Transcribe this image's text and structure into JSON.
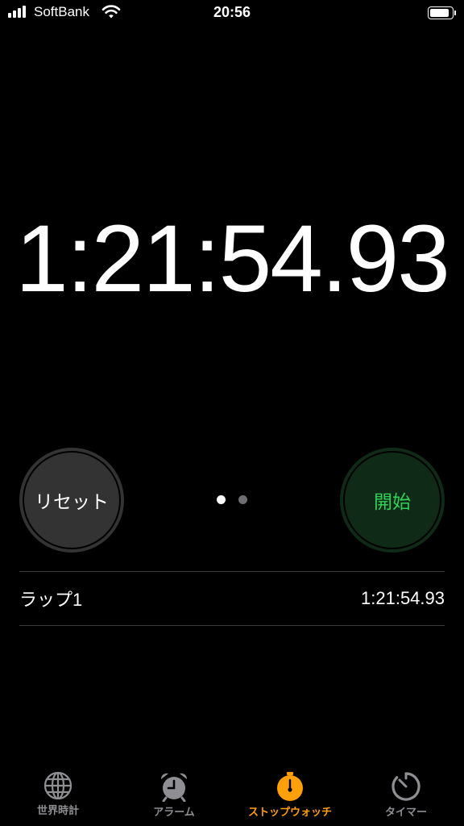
{
  "status_bar": {
    "carrier": "SoftBank",
    "time": "20:56",
    "battery_level": 0.9
  },
  "stopwatch": {
    "elapsed": "1:21:54.93"
  },
  "controls": {
    "reset_label": "リセット",
    "start_label": "開始",
    "page_count": 2,
    "current_page": 1
  },
  "laps": [
    {
      "label": "ラップ1",
      "time": "1:21:54.93"
    }
  ],
  "tabs": [
    {
      "label": "世界時計",
      "icon": "globe-icon",
      "active": false
    },
    {
      "label": "アラーム",
      "icon": "alarm-clock-icon",
      "active": false
    },
    {
      "label": "ストップウォッチ",
      "icon": "stopwatch-icon",
      "active": true
    },
    {
      "label": "タイマー",
      "icon": "timer-icon",
      "active": false
    }
  ],
  "colors": {
    "accent": "#ff9f0a",
    "start_green": "#30d158",
    "inactive_tab": "#8e8e93"
  }
}
